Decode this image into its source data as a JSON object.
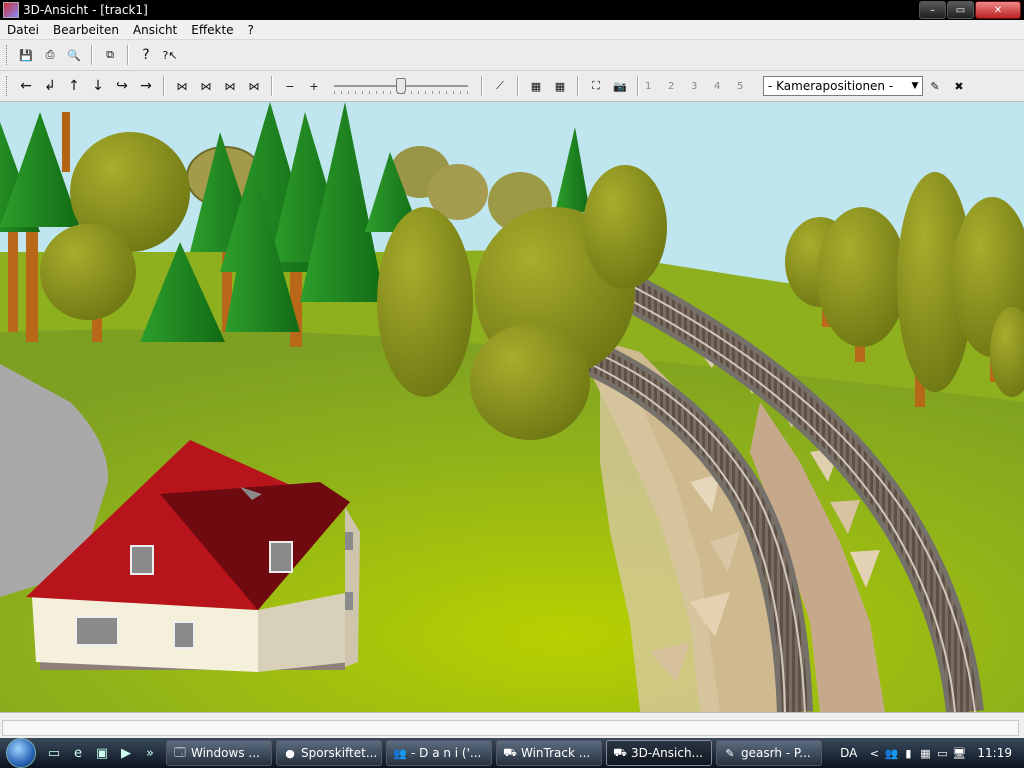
{
  "window": {
    "title": "3D-Ansicht - [track1]"
  },
  "window_buttons": {
    "minimize": "–",
    "maximize": "▭",
    "close": "✕"
  },
  "menu": [
    "Datei",
    "Bearbeiten",
    "Ansicht",
    "Effekte",
    "?"
  ],
  "toolbar1": {
    "icons": [
      "save-icon",
      "print-icon",
      "print-preview-icon",
      "copy-icon",
      "help-icon",
      "context-help-icon"
    ],
    "glyphs": {
      "save": "💾",
      "print": "⎙",
      "preview": "🔍",
      "copy": "⧉",
      "help": "?",
      "context_help": "?↖"
    }
  },
  "toolbar2": {
    "nav_glyphs": [
      "←",
      "↲",
      "↑",
      "↓",
      "↪",
      "→"
    ],
    "walk_glyphs": [
      "⋈",
      "⋈",
      "⋈",
      "⋈"
    ],
    "zoom_glyphs": [
      "−",
      "+"
    ],
    "slider_value": 0.5,
    "tool_glyphs": [
      "⟋",
      "▦",
      "▦",
      "⛶",
      "📷"
    ],
    "camera_slots": [
      "1",
      "2",
      "3",
      "4",
      "5"
    ],
    "camera_select": "- Kamerapositionen -",
    "edit_glyphs": [
      "✎",
      "✖"
    ]
  },
  "taskbar": {
    "quicklaunch": [
      "▭",
      "e",
      "▣",
      "▶",
      "»"
    ],
    "tasks": [
      {
        "label": "Windows ...",
        "icon": "🗔",
        "active": false
      },
      {
        "label": "Sporskiftet...",
        "icon": "●",
        "active": false
      },
      {
        "label": "- D a n i ('...",
        "icon": "👥",
        "active": false
      },
      {
        "label": "WinTrack ...",
        "icon": "⛟",
        "active": false
      },
      {
        "label": "3D-Ansich...",
        "icon": "⛟",
        "active": true
      },
      {
        "label": "geasrh - P...",
        "icon": "✎",
        "active": false
      }
    ],
    "language": "DA",
    "tray_glyphs": [
      "<",
      "👥",
      "▮",
      "▦",
      "▭",
      "🖥"
    ],
    "clock": "11:19"
  },
  "colors": {
    "sky": "#bfe6ee",
    "grass": "#93b51e",
    "roof": "#b8141c",
    "wall": "#f4f0dc",
    "foliage_round": "#8e9a1c",
    "foliage_conifer": "#1f8a22"
  }
}
